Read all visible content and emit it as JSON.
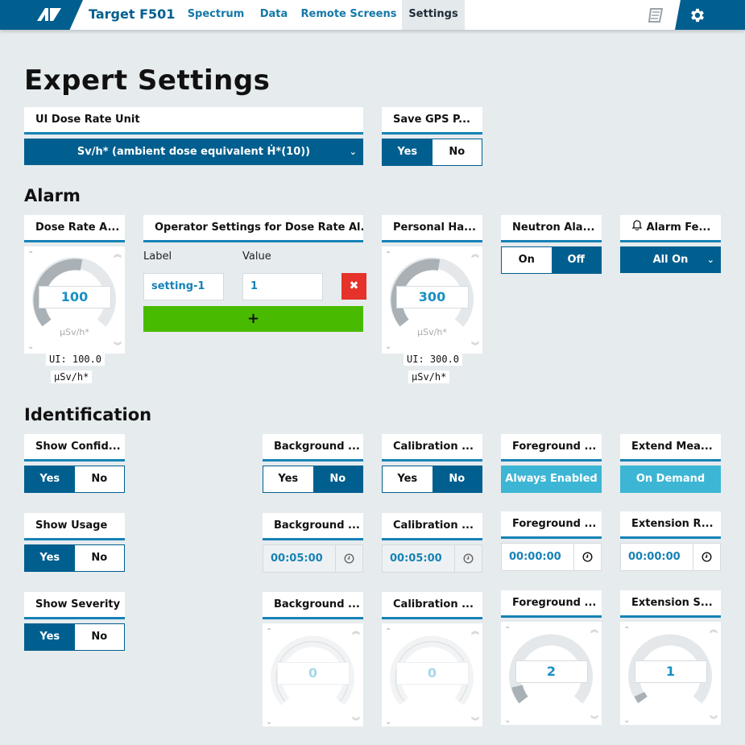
{
  "colors": {
    "primary": "#005f8f",
    "accent": "#1682b6",
    "light_blue": "#3cb6d4",
    "danger": "#e5322b",
    "success": "#48bb00",
    "background": "#e6ebee"
  },
  "header": {
    "app_title": "Target F501",
    "tabs": [
      "Spectrum",
      "Data",
      "Remote Screens",
      "Settings"
    ],
    "active_tab": "Settings",
    "icons": [
      "logo-icon",
      "manual-book-icon",
      "gear-icon"
    ]
  },
  "page_title": "Expert Settings",
  "general": {
    "ui_dose_rate_unit": {
      "label": "UI Dose Rate Unit",
      "value": "Sv/h* (ambient dose equivalent Ḣ*(10))"
    },
    "save_gps": {
      "label": "Save GPS P...",
      "options": [
        "Yes",
        "No"
      ],
      "selected": "Yes"
    }
  },
  "alarm": {
    "title": "Alarm",
    "dose_rate_alarm": {
      "label": "Dose Rate A...",
      "value": "100",
      "unit": "μSv/h*",
      "ui_value": "UI: 100.0",
      "ui_unit": "μSv/h*"
    },
    "operator_settings": {
      "label": "Operator Settings for Dose Rate Al...",
      "col_label": "Label",
      "col_value": "Value",
      "rows": [
        {
          "label": "setting-1",
          "value": "1"
        }
      ],
      "delete_symbol": "✖",
      "add_symbol": "+"
    },
    "personal_hazard": {
      "label": "Personal Ha...",
      "value": "300",
      "unit": "μSv/h*",
      "ui_value": "UI: 300.0",
      "ui_unit": "μSv/h*"
    },
    "neutron_alarm": {
      "label": "Neutron Ala...",
      "options": [
        "On",
        "Off"
      ],
      "selected": "Off"
    },
    "alarm_feedback": {
      "label": "Alarm Fe...",
      "value": "All On"
    }
  },
  "identification": {
    "title": "Identification",
    "show_confidence": {
      "label": "Show Confid...",
      "options": [
        "Yes",
        "No"
      ],
      "selected": "Yes"
    },
    "show_usage": {
      "label": "Show Usage",
      "options": [
        "Yes",
        "No"
      ],
      "selected": "Yes"
    },
    "show_severity": {
      "label": "Show Severity",
      "options": [
        "Yes",
        "No"
      ],
      "selected": "Yes"
    },
    "background_toggle": {
      "label": "Background ...",
      "options": [
        "Yes",
        "No"
      ],
      "selected": "No"
    },
    "calibration_toggle": {
      "label": "Calibration ...",
      "options": [
        "Yes",
        "No"
      ],
      "selected": "No"
    },
    "foreground_mode": {
      "label": "Foreground ...",
      "value": "Always Enabled"
    },
    "extend_measurement": {
      "label": "Extend Mea...",
      "value": "On Demand"
    },
    "background_time": {
      "label": "Background ...",
      "value": "00:05:00"
    },
    "calibration_time": {
      "label": "Calibration ...",
      "value": "00:05:00"
    },
    "foreground_time": {
      "label": "Foreground ...",
      "value": "00:00:00"
    },
    "extension_time": {
      "label": "Extension R...",
      "value": "00:00:00"
    },
    "background_count": {
      "label": "Background ...",
      "value": "0"
    },
    "calibration_count": {
      "label": "Calibration ...",
      "value": "0"
    },
    "foreground_count": {
      "label": "Foreground ...",
      "value": "2"
    },
    "extension_count": {
      "label": "Extension S...",
      "value": "1"
    }
  }
}
